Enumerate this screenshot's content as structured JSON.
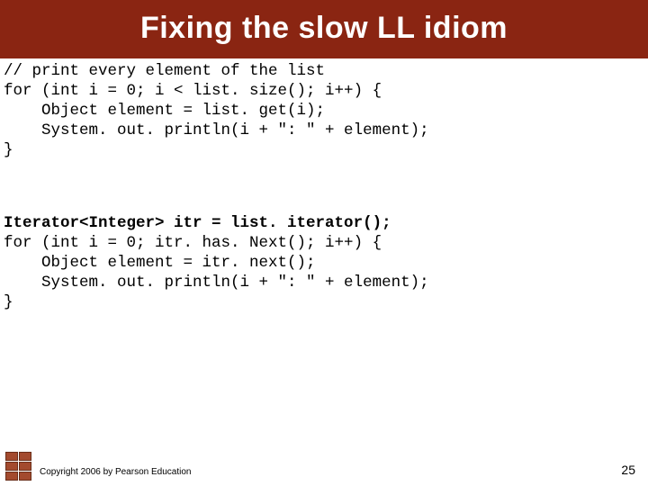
{
  "title": "Fixing the slow LL idiom",
  "code1_lines": [
    {
      "text": "// print every element of the list",
      "bold": false
    },
    {
      "text": "for (int i = 0; i < list. size(); i++) {",
      "bold": false
    },
    {
      "text": "    Object element = list. get(i);",
      "bold": false
    },
    {
      "text": "    System. out. println(i + \": \" + element);",
      "bold": false
    },
    {
      "text": "}",
      "bold": false
    }
  ],
  "code2_lines": [
    {
      "text": "Iterator<Integer> itr = list. iterator();",
      "bold": true
    },
    {
      "text": "for (int i = 0; itr. has. Next(); i++) {",
      "bold": false
    },
    {
      "text": "    Object element = itr. next();",
      "bold": false
    },
    {
      "text": "    System. out. println(i + \": \" + element);",
      "bold": false
    },
    {
      "text": "}",
      "bold": false
    }
  ],
  "footer": {
    "copyright": "Copyright 2006 by Pearson Education",
    "page": "25"
  }
}
